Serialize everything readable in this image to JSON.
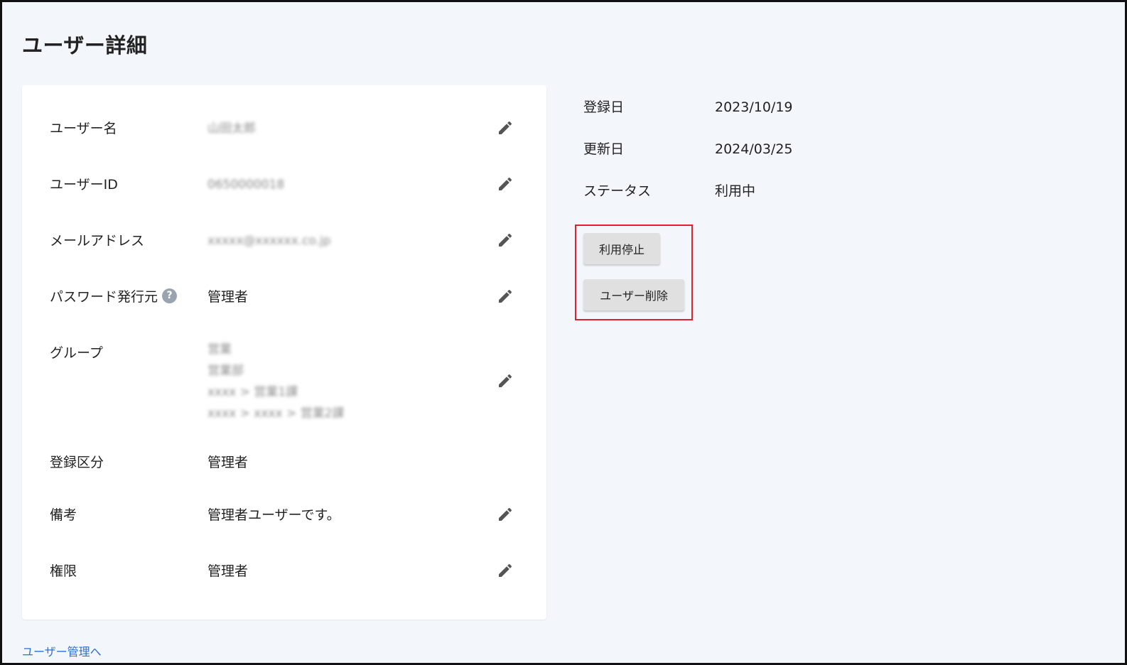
{
  "page": {
    "title": "ユーザー詳細"
  },
  "details": {
    "username": {
      "label": "ユーザー名",
      "value": "山田太郎"
    },
    "user_id": {
      "label": "ユーザーID",
      "value": "0650000018"
    },
    "email": {
      "label": "メールアドレス",
      "value": "xxxxx@xxxxxx.co.jp"
    },
    "password_issuer": {
      "label": "パスワード発行元",
      "help": "?",
      "value": "管理者"
    },
    "group": {
      "label": "グループ",
      "values": [
        "営業",
        "営業部",
        "xxxx > 営業1課",
        "xxxx > xxxx > 営業2課"
      ]
    },
    "registration_type": {
      "label": "登録区分",
      "value": "管理者"
    },
    "note": {
      "label": "備考",
      "value": "管理者ユーザーです。"
    },
    "permission": {
      "label": "権限",
      "value": "管理者"
    }
  },
  "meta": {
    "registered": {
      "label": "登録日",
      "value": "2023/10/19"
    },
    "updated": {
      "label": "更新日",
      "value": "2024/03/25"
    },
    "status": {
      "label": "ステータス",
      "value": "利用中"
    }
  },
  "actions": {
    "suspend_label": "利用停止",
    "delete_label": "ユーザー削除"
  },
  "back_link": "ユーザー管理へ",
  "icons": {
    "edit": "pencil-icon",
    "help": "question-circle-icon"
  },
  "colors": {
    "page_bg": "#f3f6fa",
    "card_bg": "#ffffff",
    "highlight": "#e0202a",
    "link": "#2f6fd0",
    "icon": "#555555"
  }
}
